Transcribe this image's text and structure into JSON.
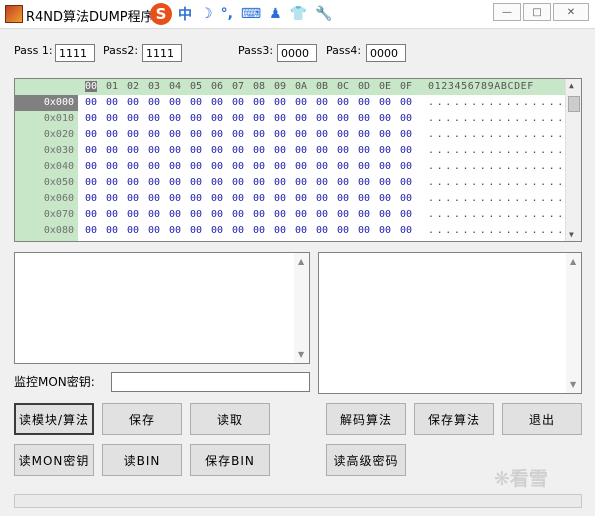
{
  "window": {
    "title": "R4ND算法DUMP程序",
    "ime_items": [
      "中",
      "☽",
      "°,",
      "⌨",
      "♟",
      "👕",
      "🔧"
    ],
    "controls": [
      "—",
      "□",
      "✕"
    ]
  },
  "pass_fields": [
    {
      "label": "Pass 1:",
      "value": "1111"
    },
    {
      "label": "Pass2:",
      "value": "1111"
    },
    {
      "label": "Pass3:",
      "value": "0000"
    },
    {
      "label": "Pass4:",
      "value": "0000"
    }
  ],
  "hex_view": {
    "column_headers": [
      "00",
      "01",
      "02",
      "03",
      "04",
      "05",
      "06",
      "07",
      "08",
      "09",
      "0A",
      "0B",
      "0C",
      "0D",
      "0E",
      "0F"
    ],
    "ascii_header": "0123456789ABCDEF",
    "rows": [
      {
        "addr": "0x000",
        "bytes": [
          "00",
          "00",
          "00",
          "00",
          "00",
          "00",
          "00",
          "00",
          "00",
          "00",
          "00",
          "00",
          "00",
          "00",
          "00",
          "00"
        ],
        "ascii": "................"
      },
      {
        "addr": "0x010",
        "bytes": [
          "00",
          "00",
          "00",
          "00",
          "00",
          "00",
          "00",
          "00",
          "00",
          "00",
          "00",
          "00",
          "00",
          "00",
          "00",
          "00"
        ],
        "ascii": "................"
      },
      {
        "addr": "0x020",
        "bytes": [
          "00",
          "00",
          "00",
          "00",
          "00",
          "00",
          "00",
          "00",
          "00",
          "00",
          "00",
          "00",
          "00",
          "00",
          "00",
          "00"
        ],
        "ascii": "................"
      },
      {
        "addr": "0x030",
        "bytes": [
          "00",
          "00",
          "00",
          "00",
          "00",
          "00",
          "00",
          "00",
          "00",
          "00",
          "00",
          "00",
          "00",
          "00",
          "00",
          "00"
        ],
        "ascii": "................"
      },
      {
        "addr": "0x040",
        "bytes": [
          "00",
          "00",
          "00",
          "00",
          "00",
          "00",
          "00",
          "00",
          "00",
          "00",
          "00",
          "00",
          "00",
          "00",
          "00",
          "00"
        ],
        "ascii": "................"
      },
      {
        "addr": "0x050",
        "bytes": [
          "00",
          "00",
          "00",
          "00",
          "00",
          "00",
          "00",
          "00",
          "00",
          "00",
          "00",
          "00",
          "00",
          "00",
          "00",
          "00"
        ],
        "ascii": "................"
      },
      {
        "addr": "0x060",
        "bytes": [
          "00",
          "00",
          "00",
          "00",
          "00",
          "00",
          "00",
          "00",
          "00",
          "00",
          "00",
          "00",
          "00",
          "00",
          "00",
          "00"
        ],
        "ascii": "................"
      },
      {
        "addr": "0x070",
        "bytes": [
          "00",
          "00",
          "00",
          "00",
          "00",
          "00",
          "00",
          "00",
          "00",
          "00",
          "00",
          "00",
          "00",
          "00",
          "00",
          "00"
        ],
        "ascii": "................"
      },
      {
        "addr": "0x080",
        "bytes": [
          "00",
          "00",
          "00",
          "00",
          "00",
          "00",
          "00",
          "00",
          "00",
          "00",
          "00",
          "00",
          "00",
          "00",
          "00",
          "00"
        ],
        "ascii": "................"
      }
    ]
  },
  "monitor": {
    "label": "监控MON密钥:",
    "value": ""
  },
  "buttons": {
    "read_module": "读模块/算法",
    "save": "保存",
    "read": "读取",
    "decode": "解码算法",
    "save_algo": "保存算法",
    "exit": "退出",
    "read_mon_key": "读MON密钥",
    "read_bin": "读BIN",
    "save_bin": "保存BIN",
    "read_adv_pass": "读高级密码"
  },
  "watermark": "❋看雪"
}
